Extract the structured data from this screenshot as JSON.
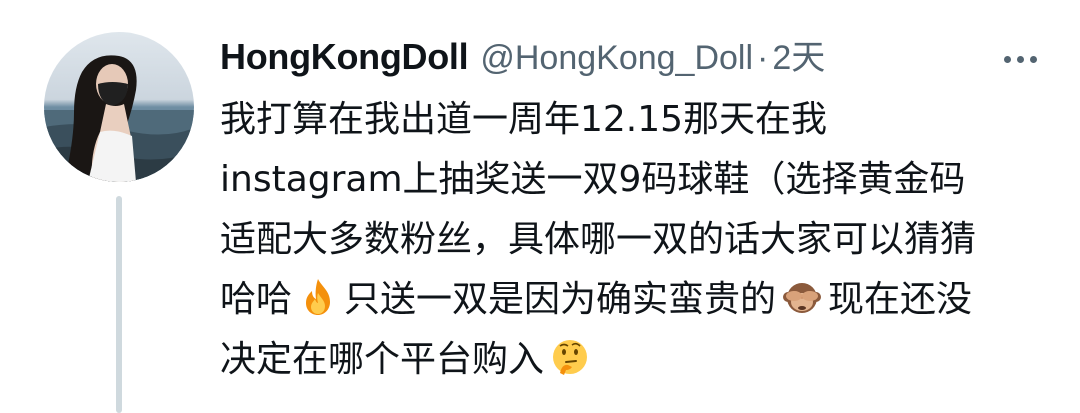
{
  "tweet": {
    "display_name": "HongKongDoll",
    "handle": "@HongKong_Doll",
    "dot": "·",
    "time": "2天",
    "text_part1": "我打算在我出道一周年12.15那天在我instagram上抽奖送一双9码球鞋（选择黄金码适配大多数粉丝，具体哪一双的话大家可以猜猜哈哈",
    "text_part2": "只送一双是因为确实蛮贵的",
    "text_part3": "现在还没决定在哪个平台购入",
    "emojis": [
      "fire-emoji",
      "see-no-evil-monkey-emoji",
      "thinking-face-emoji"
    ]
  },
  "colors": {
    "text": "#0f1419",
    "secondary": "#536471",
    "thread_line": "#cfd9de"
  }
}
